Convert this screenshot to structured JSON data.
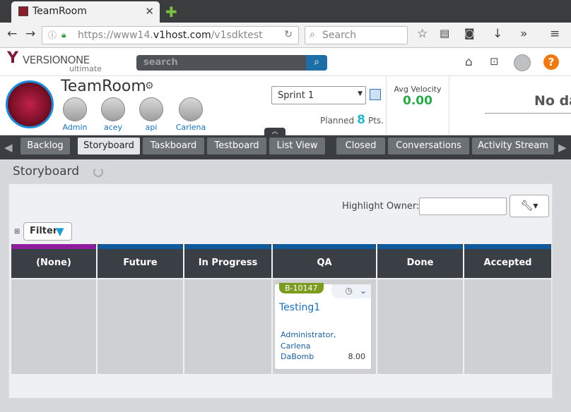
{
  "browser": {
    "tab_title": "TeamRoom",
    "url_prefix": "https://www14.",
    "url_host": "v1host.com",
    "url_path": "/v1sdktest",
    "search_placeholder": "Search"
  },
  "app": {
    "logo_name": "VERSIONONE",
    "logo_sub": "ultimate",
    "search_placeholder": "search"
  },
  "team": {
    "name": "TeamRoom",
    "members": [
      "Admin",
      "acey",
      "api",
      "Carlena"
    ],
    "sprint": "Sprint 1",
    "planned_label": "Planned",
    "planned_value": "8",
    "planned_unit": "Pts.",
    "velocity_label": "Avg Velocity",
    "velocity_value": "0.00",
    "no_data_text": "No da"
  },
  "tabs": [
    "Backlog",
    "Storyboard",
    "Taskboard",
    "Testboard",
    "List View",
    "Closed",
    "Conversations",
    "Activity Stream"
  ],
  "active_tab": "Storyboard",
  "page": {
    "title": "Storyboard",
    "highlight_label": "Highlight Owner:",
    "filter_label": "Filter"
  },
  "columns": [
    {
      "name": "(None)",
      "color": "#8e1e9e"
    },
    {
      "name": "Future",
      "color": "#0f5a9c"
    },
    {
      "name": "In Progress",
      "color": "#0f5a9c"
    },
    {
      "name": "QA",
      "color": "#0f5a9c"
    },
    {
      "name": "Done",
      "color": "#0f5a9c"
    },
    {
      "name": "Accepted",
      "color": "#0f5a9c"
    }
  ],
  "card": {
    "id": "B-10147",
    "title": "Testing1",
    "owners_line1": "Administrator,",
    "owners_line2": "Carlena",
    "team": "DaBomb",
    "estimate": "8.00",
    "badge_color": "#7b9c1e"
  }
}
